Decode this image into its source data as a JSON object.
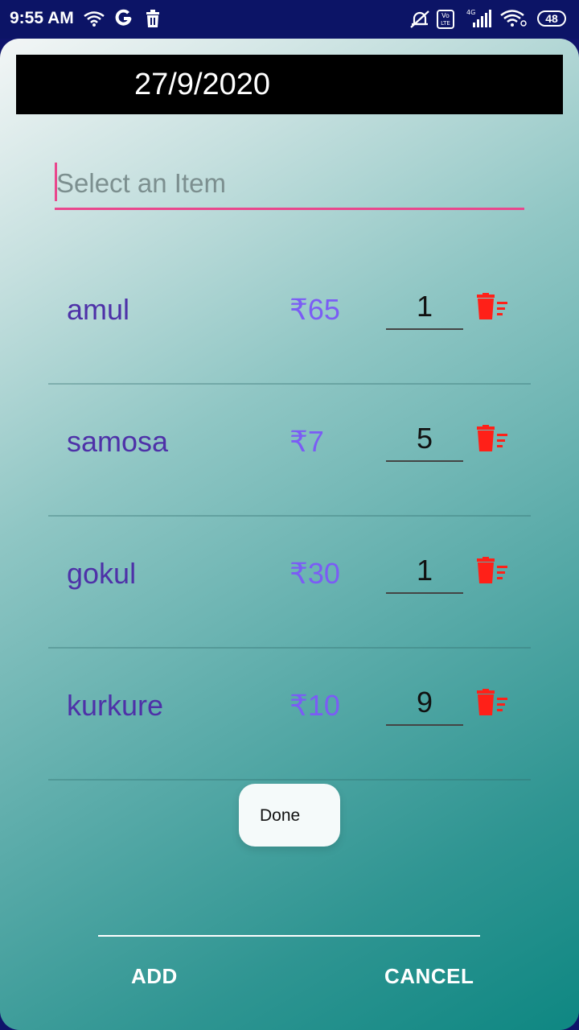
{
  "status_bar": {
    "time": "9:55 AM",
    "battery": "48",
    "icons": [
      "wifi-signal-icon",
      "google-g-icon",
      "trash-icon",
      "alarm-off-icon",
      "volte-icon",
      "cell-signal-icon",
      "wifi-icon",
      "battery-icon"
    ]
  },
  "date": "27/9/2020",
  "search": {
    "placeholder": "Select an Item",
    "value": ""
  },
  "items": [
    {
      "name": "amul",
      "price": "₹65",
      "qty": "1"
    },
    {
      "name": "samosa",
      "price": "₹7",
      "qty": "5"
    },
    {
      "name": "gokul",
      "price": "₹30",
      "qty": "1"
    },
    {
      "name": "kurkure",
      "price": "₹10",
      "qty": "9"
    }
  ],
  "keyboard_popup": {
    "label": "Done"
  },
  "actions": {
    "add_label": "ADD",
    "cancel_label": "CANCEL"
  },
  "colors": {
    "status_bar_bg": "#0c1466",
    "accent": "#e9478d",
    "item_name": "#4e31a8",
    "item_price": "#7b5cf5",
    "delete_icon": "#ff2018",
    "gradient_start": "#f3f6f6",
    "gradient_end": "#0e8782"
  }
}
